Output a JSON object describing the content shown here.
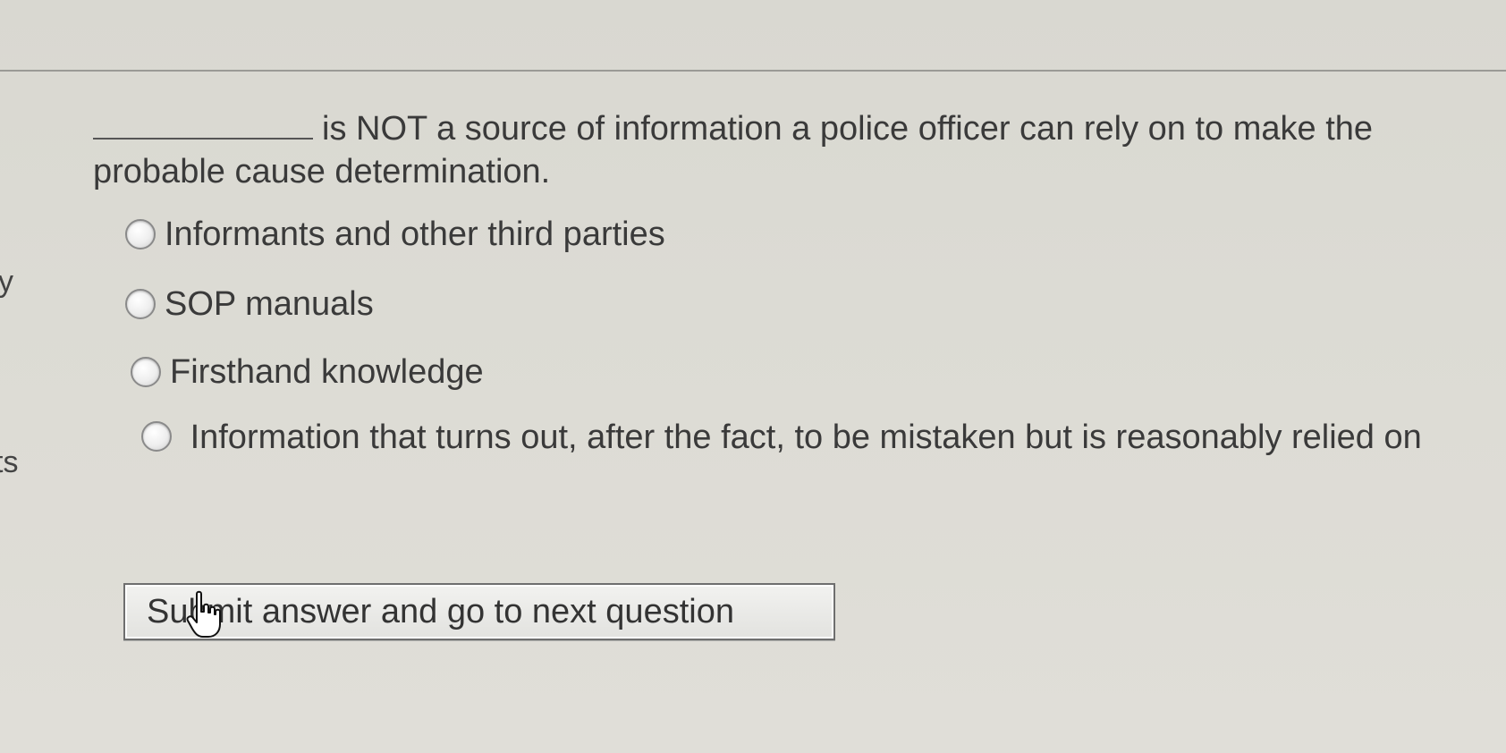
{
  "sidebar": {
    "fragment_1": "y",
    "fragment_2": "ts"
  },
  "question": {
    "text": "is NOT a source of information a police officer can rely on to make the probable cause determination."
  },
  "options": [
    {
      "label": "Informants and other third parties"
    },
    {
      "label": "SOP manuals"
    },
    {
      "label": "Firsthand knowledge"
    },
    {
      "label": "Information that turns out, after the fact, to be mistaken but is reasonably relied on"
    }
  ],
  "submit": {
    "label": "Submit answer and go to next question"
  },
  "icons": {
    "cursor": "hand-pointer-cursor-icon"
  }
}
